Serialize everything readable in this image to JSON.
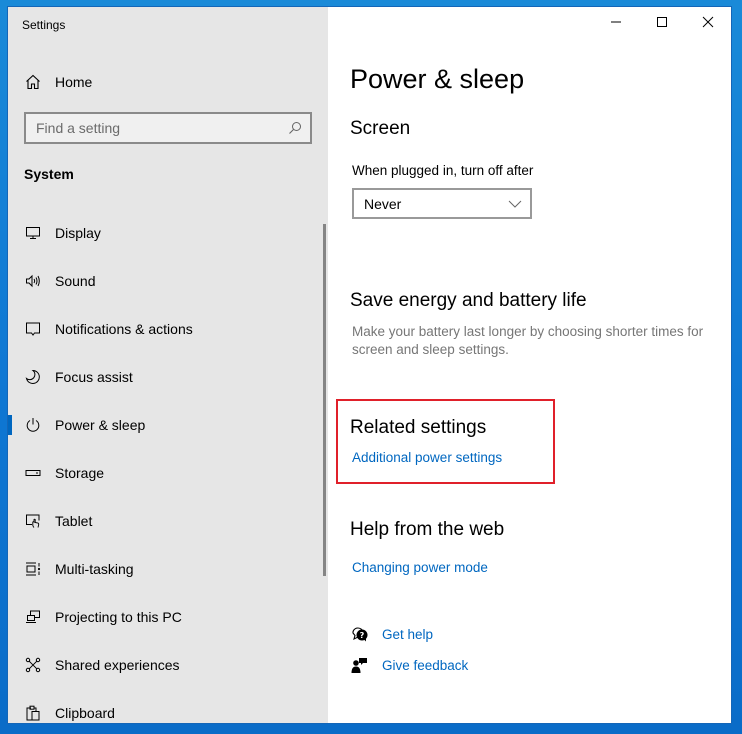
{
  "window": {
    "app_title": "Settings",
    "caption": {
      "minimize_icon": "minimize-icon",
      "maximize_icon": "maximize-icon",
      "close_icon": "close-icon"
    }
  },
  "sidebar": {
    "home": {
      "label": "Home",
      "icon": "home-icon"
    },
    "search": {
      "placeholder": "Find a setting",
      "value": "",
      "icon": "search-icon"
    },
    "section_label": "System",
    "items": [
      {
        "label": "Display",
        "icon": "monitor-icon",
        "active": false
      },
      {
        "label": "Sound",
        "icon": "speaker-icon",
        "active": false
      },
      {
        "label": "Notifications & actions",
        "icon": "notification-icon",
        "active": false
      },
      {
        "label": "Focus assist",
        "icon": "moon-icon",
        "active": false
      },
      {
        "label": "Power & sleep",
        "icon": "power-icon",
        "active": true
      },
      {
        "label": "Storage",
        "icon": "storage-icon",
        "active": false
      },
      {
        "label": "Tablet",
        "icon": "tablet-icon",
        "active": false
      },
      {
        "label": "Multi-tasking",
        "icon": "multitasking-icon",
        "active": false
      },
      {
        "label": "Projecting to this PC",
        "icon": "projecting-icon",
        "active": false
      },
      {
        "label": "Shared experiences",
        "icon": "shared-experiences-icon",
        "active": false
      },
      {
        "label": "Clipboard",
        "icon": "clipboard-icon",
        "active": false
      }
    ]
  },
  "main": {
    "page_title": "Power & sleep",
    "screen": {
      "heading": "Screen",
      "plugged_in_label": "When plugged in, turn off after",
      "plugged_in_value": "Never"
    },
    "save_energy": {
      "heading": "Save energy and battery life",
      "description": "Make your battery last longer by choosing shorter times for screen and sleep settings."
    },
    "related_settings": {
      "heading": "Related settings",
      "link": "Additional power settings"
    },
    "help_web": {
      "heading": "Help from the web",
      "link": "Changing power mode"
    },
    "support": {
      "get_help": "Get help",
      "give_feedback": "Give feedback"
    }
  },
  "colors": {
    "accent": "#0067c0",
    "sidebar_bg": "#e6e6e6",
    "highlight_box": "#e0202a"
  }
}
